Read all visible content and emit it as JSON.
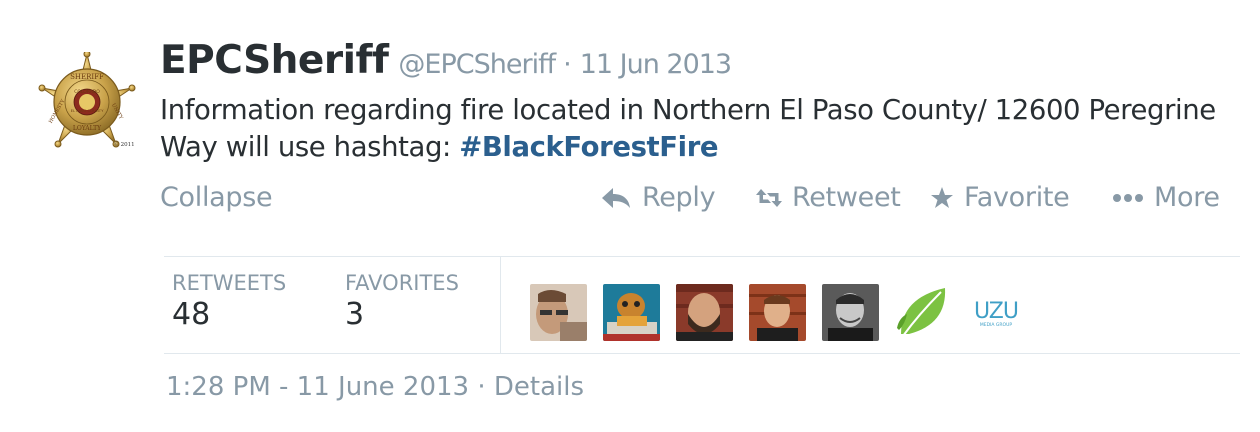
{
  "tweet": {
    "fullname": "EPCSheriff",
    "username": "@EPCSheriff",
    "separator": "·",
    "date_short": "11 Jun 2013",
    "text_main": "Information regarding fire located in Northern El Paso County/ 12600 Peregrine Way will use hashtag: ",
    "hashtag": "#BlackForestFire",
    "avatar_seal": {
      "top_text": "SHERIFF",
      "ring_text": "EL PASO COUNTY",
      "state_text": "COLORADO",
      "bottom_text": "LOYALTY",
      "left_text": "HONESTY",
      "right_text": "UNITY",
      "copyright": "© 2011"
    }
  },
  "actions": {
    "collapse": "Collapse",
    "reply": "Reply",
    "retweet": "Retweet",
    "favorite": "Favorite",
    "more": "More"
  },
  "stats": {
    "retweets_label": "RETWEETS",
    "retweets_value": "48",
    "favorites_label": "FAVORITES",
    "favorites_value": "3",
    "uzu_logo_text": "UZU",
    "uzu_logo_sub": "MEDIA GROUP"
  },
  "footer": {
    "time": "1:28 PM - 11 June 2013",
    "separator": "·",
    "details": "Details"
  },
  "colors": {
    "text": "#292f33",
    "muted": "#8899a6",
    "hashtag": "#2b5f8e",
    "border": "#e1e8ed",
    "leaf_green": "#7cc242",
    "uzu_blue": "#3f9fc6"
  }
}
